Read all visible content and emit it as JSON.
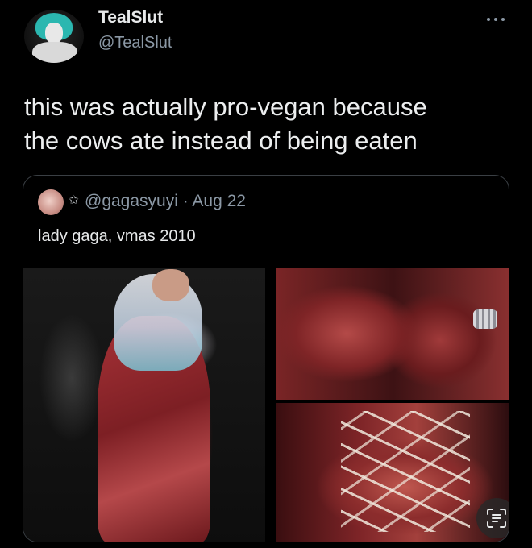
{
  "author": {
    "display_name": "TealSlut",
    "handle": "@TealSlut",
    "avatar_icon": "teal-haired-avatar-icon"
  },
  "tweet": {
    "text_line1": "this was actually pro-vegan because",
    "text_line2": "the cows ate instead of being eaten"
  },
  "quoted_tweet": {
    "handle_and_date": "@gagasyuyi · Aug 22",
    "badge_icon": "star-icon",
    "text": "lady gaga, vmas 2010",
    "media_count": 3
  },
  "icons": {
    "more": "more-options-icon",
    "scan": "text-recognition-icon"
  },
  "colors": {
    "background": "#000000",
    "primary_text": "#e7e9ea",
    "secondary_text": "#8b98a5",
    "card_border": "#3a3f44"
  }
}
